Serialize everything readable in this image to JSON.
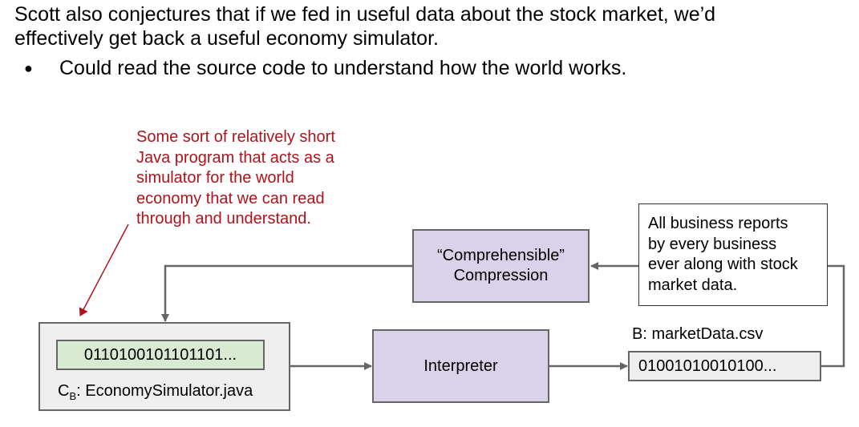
{
  "slide": {
    "lines": [
      "Scott also conjectures that if we fed in useful data about the stock market, we’d",
      "effectively get back a useful economy simulator."
    ],
    "bullet_marker": "●",
    "bullet": "Could read the source code to understand how the world works."
  },
  "diagram": {
    "annotation": [
      "Some sort of relatively short",
      "Java program that acts as a",
      "simulator for the world",
      "economy that we can read",
      "through and understand."
    ],
    "compression_box": [
      "“Comprehensible”",
      "Compression"
    ],
    "reports_box": [
      "All business reports",
      "by every business",
      "ever along with stock",
      "market data."
    ],
    "program_bits": "0110100101101101...",
    "program_label_prefix": "C",
    "program_label_sub": "B",
    "program_label_rest": ": EconomySimulator.java",
    "interpreter": "Interpreter",
    "data_label": "B: marketData.csv",
    "data_bits": "01001010010100...",
    "colors": {
      "annotation": "#b0131b",
      "process_fill": "#d9d2e9",
      "bits_fill": "#d9ead3",
      "file_fill": "#efefef",
      "stroke": "#666666"
    }
  }
}
